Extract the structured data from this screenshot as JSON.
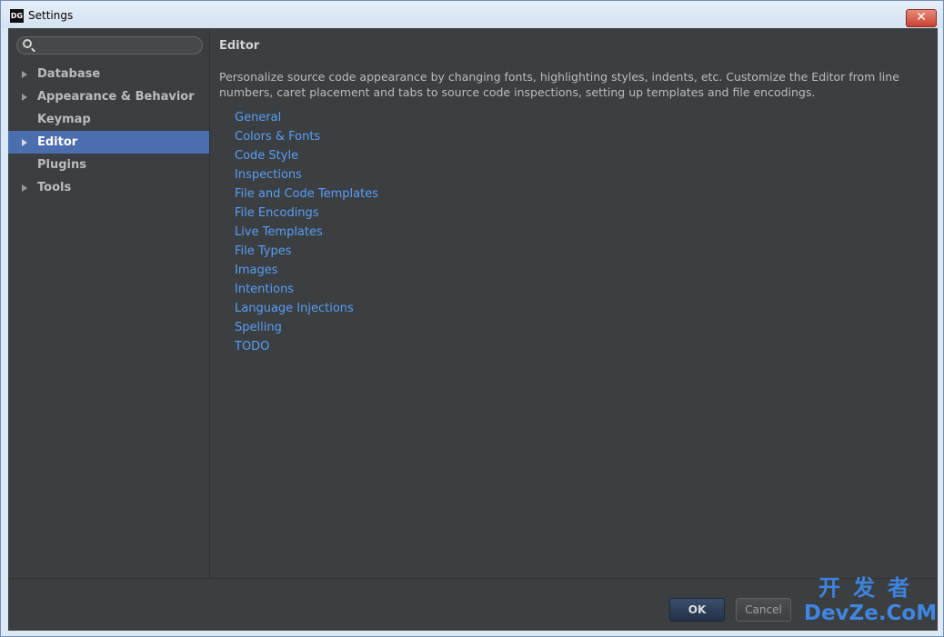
{
  "window": {
    "title": "Settings",
    "icon_text": "DG",
    "close_label": "✕"
  },
  "search": {
    "placeholder": ""
  },
  "sidebar": {
    "items": [
      {
        "label": "Database",
        "expandable": true
      },
      {
        "label": "Appearance & Behavior",
        "expandable": true
      },
      {
        "label": "Keymap",
        "expandable": false
      },
      {
        "label": "Editor",
        "expandable": true,
        "selected": true
      },
      {
        "label": "Plugins",
        "expandable": false
      },
      {
        "label": "Tools",
        "expandable": true
      }
    ]
  },
  "main": {
    "title": "Editor",
    "description": "Personalize source code appearance by changing fonts, highlighting styles, indents, etc. Customize the Editor from line numbers, caret placement and tabs to source code inspections, setting up templates and file encodings.",
    "links": [
      "General",
      "Colors & Fonts",
      "Code Style",
      "Inspections",
      "File and Code Templates",
      "File Encodings",
      "Live Templates",
      "File Types",
      "Images",
      "Intentions",
      "Language Injections",
      "Spelling",
      "TODO"
    ]
  },
  "footer": {
    "ok_label": "OK",
    "cancel_label": "Cancel"
  },
  "watermark": {
    "top": "开发者",
    "bottom": "DevZe.CoM"
  }
}
